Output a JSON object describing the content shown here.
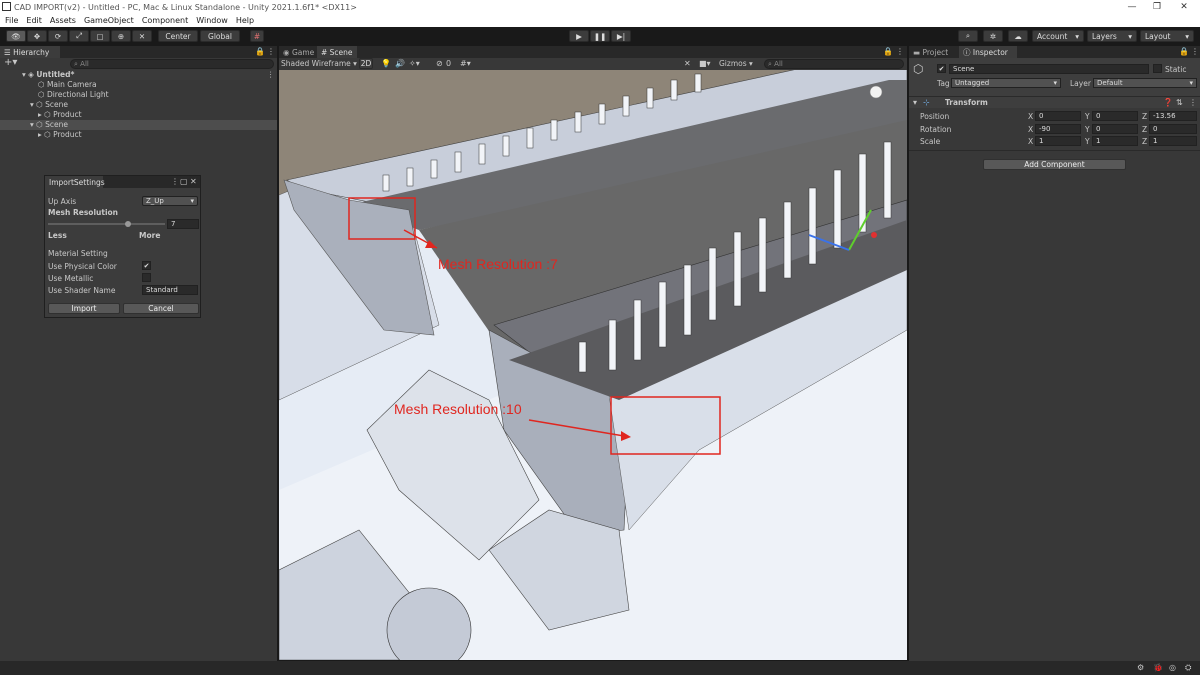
{
  "window": {
    "title": "CAD IMPORT(v2) - Untitled - PC, Mac & Linux Standalone - Unity 2021.1.6f1* <DX11>",
    "minimize": "—",
    "restore": "❐",
    "close": "✕"
  },
  "menu": [
    "File",
    "Edit",
    "Assets",
    "GameObject",
    "Component",
    "Window",
    "Help"
  ],
  "toolbar": {
    "center": "Center",
    "global": "Global",
    "account": "Account",
    "layers": "Layers",
    "layout": "Layout"
  },
  "hierarchy": {
    "tab": "Hierarchy",
    "search_placeholder": "All",
    "items": [
      {
        "label": "Untitled*"
      },
      {
        "label": "Main Camera"
      },
      {
        "label": "Directional Light"
      },
      {
        "label": "Scene"
      },
      {
        "label": "Product"
      },
      {
        "label": "Scene"
      },
      {
        "label": "Product"
      }
    ]
  },
  "import_settings": {
    "title": "ImportSettings",
    "up_axis_label": "Up Axis",
    "up_axis_value": "Z_Up",
    "mesh_resolution_label": "Mesh Resolution",
    "mesh_resolution_value": "7",
    "less": "Less",
    "more": "More",
    "material_setting": "Material Setting",
    "use_physical_color": "Use Physical Color",
    "use_metallic": "Use Metallic",
    "use_shader_name": "Use Shader Name",
    "shader_name_value": "Standard",
    "import_button": "Import",
    "cancel_button": "Cancel",
    "checkmark": "✔"
  },
  "scene_view": {
    "tab_game": "Game",
    "tab_scene": "Scene",
    "shading_mode": "Shaded Wireframe",
    "mode_2d": "2D",
    "hidden_count": "0",
    "gizmos": "Gizmos",
    "search_placeholder": "All",
    "annotation_1": "Mesh Resolution :7",
    "annotation_2": "Mesh Resolution :10"
  },
  "inspector": {
    "tab_project": "Project",
    "tab_inspector": "Inspector",
    "object_name": "Scene",
    "static_label": "Static",
    "tag_label": "Tag",
    "tag_value": "Untagged",
    "layer_label": "Layer",
    "layer_value": "Default",
    "transform_label": "Transform",
    "position_label": "Position",
    "rotation_label": "Rotation",
    "scale_label": "Scale",
    "position": {
      "x": "0",
      "y": "0",
      "z": "-13.56"
    },
    "rotation": {
      "x": "-90",
      "y": "0",
      "z": "0"
    },
    "scale": {
      "x": "1",
      "y": "1",
      "z": "1"
    },
    "add_component": "Add Component",
    "x": "X",
    "y": "Y",
    "z": "Z"
  },
  "colors": {
    "annotation": "#e0261f",
    "accent_blue": "#3a72b0",
    "panel_bg": "#383838"
  }
}
